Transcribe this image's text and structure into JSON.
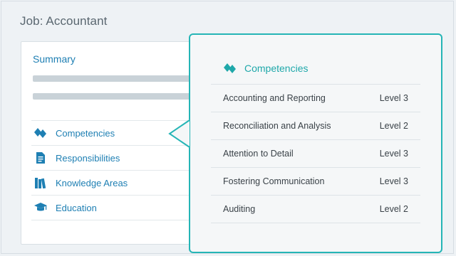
{
  "job": {
    "title": "Job: Accountant"
  },
  "summary": {
    "title": "Summary",
    "nav": [
      {
        "label": "Competencies",
        "icon": "competencies-icon"
      },
      {
        "label": "Responsibilities",
        "icon": "document-icon"
      },
      {
        "label": "Knowledge Areas",
        "icon": "books-icon"
      },
      {
        "label": "Education",
        "icon": "graduation-cap-icon"
      }
    ]
  },
  "popover": {
    "title": "Competencies",
    "icon": "competencies-icon",
    "rows": [
      {
        "name": "Accounting and Reporting",
        "level": "Level 3"
      },
      {
        "name": "Reconciliation and Analysis",
        "level": "Level 2"
      },
      {
        "name": "Attention to Detail",
        "level": "Level 3"
      },
      {
        "name": "Fostering Communication",
        "level": "Level 3"
      },
      {
        "name": "Auditing",
        "level": "Level 2"
      }
    ]
  },
  "colors": {
    "link_blue": "#1e7fb3",
    "accent_teal": "#25b5b6",
    "text_gray": "#5a6770",
    "placeholder_gray": "#c9d2d8"
  }
}
